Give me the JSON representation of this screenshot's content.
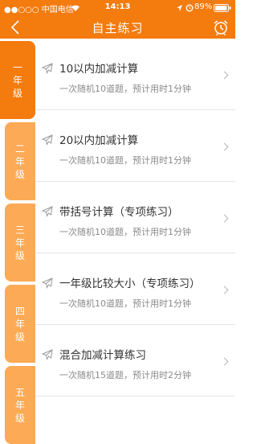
{
  "status_bar": {
    "carrier": "●●○○○ 中国电信",
    "time": "14:13",
    "battery": "89%"
  },
  "header": {
    "title": "自主练习",
    "back_icon": "chevron-left-icon",
    "right_icon": "alarm-clock-icon"
  },
  "colors": {
    "accent": "#f47b0e",
    "tab_inactive": "#fcaa55"
  },
  "sidebar": {
    "active_index": 0,
    "tabs": [
      {
        "label": "一年级"
      },
      {
        "label": "二年级"
      },
      {
        "label": "三年级"
      },
      {
        "label": "四年级"
      },
      {
        "label": "五年级"
      }
    ]
  },
  "exercises": [
    {
      "title": "10以内加减计算",
      "subtitle": "一次随机10道题，预计用时1分钟"
    },
    {
      "title": "20以内加减计算",
      "subtitle": "一次随机10道题，预计用时1分钟"
    },
    {
      "title": "带括号计算（专项练习）",
      "subtitle": "一次随机10道题，预计用时1分钟"
    },
    {
      "title": "一年级比较大小（专项练习）",
      "subtitle": "一次随机10道题，预计用时1分钟"
    },
    {
      "title": "混合加减计算练习",
      "subtitle": "一次随机15道题，预计用时2分钟"
    }
  ]
}
